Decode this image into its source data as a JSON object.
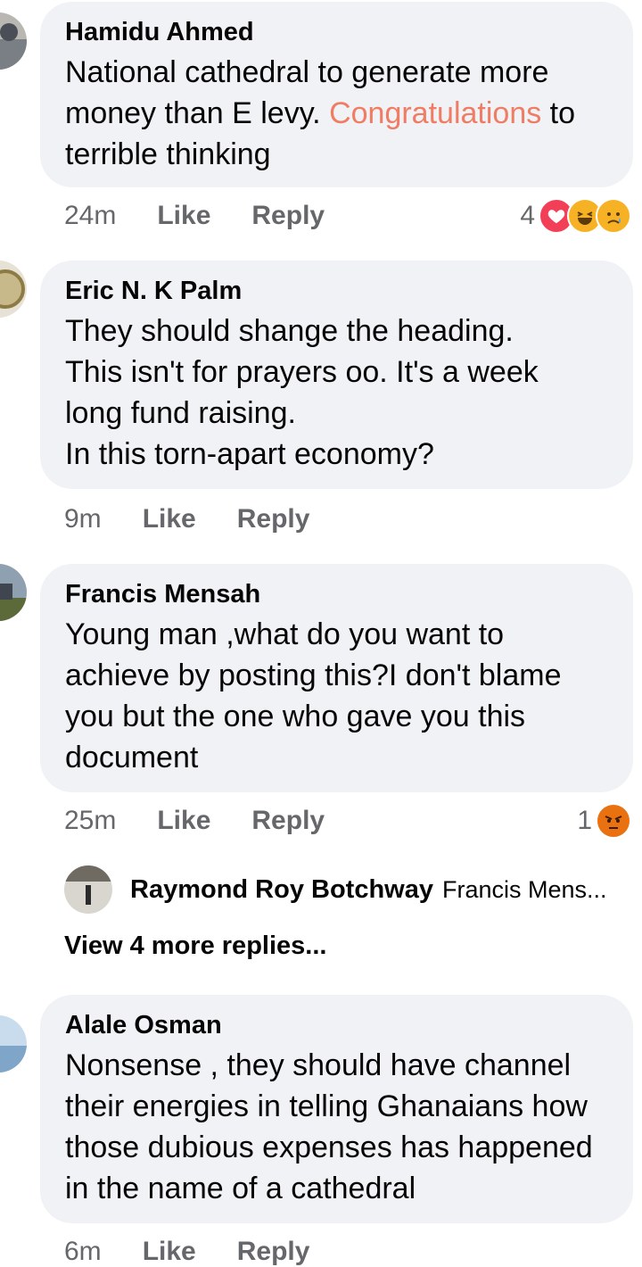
{
  "comments": [
    {
      "name": "Hamidu Ahmed",
      "text_before": "National cathedral to generate more money than E levy. ",
      "highlight": "Congratulations",
      "text_after": " to terrible thinking",
      "time": "24m",
      "like": "Like",
      "reply": "Reply",
      "reaction_count": "4",
      "reactions": [
        "heart-icon",
        "haha-icon",
        "sad-icon"
      ]
    },
    {
      "name": "Eric N. K Palm",
      "lines": [
        "They should shange the heading.",
        "This isn't for prayers oo. It's a week long fund raising.",
        "In this torn-apart economy?"
      ],
      "time": "9m",
      "like": "Like",
      "reply": "Reply"
    },
    {
      "name": "Francis Mensah",
      "text": "Young man ,what do you want to achieve by posting this?I don't blame you but the one who gave you this document",
      "time": "25m",
      "like": "Like",
      "reply": "Reply",
      "reaction_count": "1",
      "reactions": [
        "angry-icon"
      ]
    },
    {
      "name": "Alale Osman",
      "text": "Nonsense , they should have channel their energies in telling Ghanaians how those dubious expenses has happened in the name of a cathedral",
      "time": "6m",
      "like": "Like",
      "reply": "Reply"
    }
  ],
  "reply_preview": {
    "name": "Raymond Roy Botchway",
    "preview": "Francis Mens..."
  },
  "view_more": "View 4 more replies...",
  "colors": {
    "bubble": "#f0f2f5",
    "highlight": "#f07c63",
    "meta": "#65676b"
  }
}
